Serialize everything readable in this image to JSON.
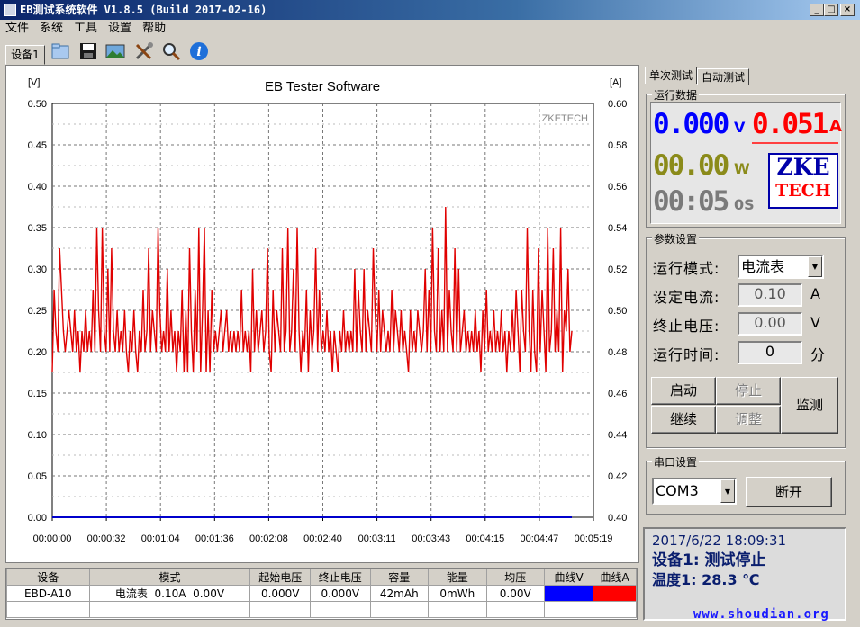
{
  "window": {
    "title": "EB测试系统软件 V1.8.5 (Build 2017-02-16)",
    "min": "_",
    "max": "□",
    "close": "×"
  },
  "menu": [
    "文件",
    "系统",
    "工具",
    "设置",
    "帮助"
  ],
  "device_tab": "设备1",
  "toolbar_icons": [
    "open-folder-icon",
    "save-icon",
    "picture-icon",
    "tools-icon",
    "magnifier-icon",
    "info-icon"
  ],
  "chart_data": {
    "type": "line",
    "title": "EB Tester Software",
    "watermark": "ZKETECH",
    "ylabel_left": "[V]",
    "ylabel_right": "[A]",
    "ylim_left": [
      0,
      0.5
    ],
    "ylim_right": [
      0.4,
      0.6
    ],
    "yticks_left": [
      "0.50",
      "0.45",
      "0.40",
      "0.35",
      "0.30",
      "0.25",
      "0.20",
      "0.15",
      "0.10",
      "0.05",
      "0.00"
    ],
    "yticks_right": [
      "0.60",
      "0.58",
      "0.56",
      "0.54",
      "0.52",
      "0.50",
      "0.48",
      "0.46",
      "0.44",
      "0.42",
      "0.40"
    ],
    "xticks": [
      "00:00:00",
      "00:00:32",
      "00:01:04",
      "00:01:36",
      "00:02:08",
      "00:02:40",
      "00:03:11",
      "00:03:43",
      "00:04:15",
      "00:04:47",
      "00:05:19"
    ],
    "xlim_seconds": [
      0,
      319
    ],
    "series": [
      {
        "axis": "right",
        "color": "#e00000",
        "values": [
          0.47,
          0.51,
          0.49,
          0.48,
          0.53,
          0.51,
          0.49,
          0.48,
          0.49,
          0.5,
          0.49,
          0.48,
          0.5,
          0.48,
          0.49,
          0.47,
          0.49,
          0.48,
          0.5,
          0.48,
          0.49,
          0.48,
          0.51,
          0.48,
          0.54,
          0.5,
          0.48,
          0.54,
          0.49,
          0.48,
          0.52,
          0.48,
          0.53,
          0.49,
          0.48,
          0.5,
          0.48,
          0.49,
          0.48,
          0.5,
          0.48,
          0.47,
          0.49,
          0.48,
          0.5,
          0.48,
          0.47,
          0.49,
          0.48,
          0.51,
          0.48,
          0.49,
          0.53,
          0.48,
          0.5,
          0.49,
          0.48,
          0.54,
          0.5,
          0.48,
          0.49,
          0.48,
          0.52,
          0.48,
          0.5,
          0.48,
          0.49,
          0.47,
          0.49,
          0.48,
          0.51,
          0.47,
          0.5,
          0.47,
          0.53,
          0.49,
          0.47,
          0.51,
          0.48,
          0.54,
          0.47,
          0.5,
          0.54,
          0.47,
          0.5,
          0.47,
          0.51,
          0.48,
          0.49,
          0.48,
          0.49,
          0.5,
          0.48,
          0.49,
          0.5,
          0.48,
          0.49,
          0.48,
          0.49,
          0.48,
          0.49,
          0.48,
          0.51,
          0.48,
          0.49,
          0.48,
          0.49,
          0.47,
          0.52,
          0.48,
          0.5,
          0.48,
          0.49,
          0.5,
          0.48,
          0.49,
          0.53,
          0.48,
          0.47,
          0.51,
          0.48,
          0.5,
          0.49,
          0.48,
          0.53,
          0.48,
          0.49,
          0.54,
          0.48,
          0.49,
          0.52,
          0.48,
          0.54,
          0.49,
          0.47,
          0.49,
          0.48,
          0.51,
          0.47,
          0.5,
          0.48,
          0.49,
          0.53,
          0.48,
          0.51,
          0.48,
          0.49,
          0.48,
          0.5,
          0.48,
          0.49,
          0.47,
          0.49,
          0.48,
          0.47,
          0.49,
          0.48,
          0.5,
          0.48,
          0.49,
          0.48,
          0.49,
          0.48,
          0.52,
          0.48,
          0.51,
          0.49,
          0.48,
          0.52,
          0.48,
          0.5,
          0.49,
          0.48,
          0.53,
          0.5,
          0.48,
          0.51,
          0.48,
          0.5,
          0.49,
          0.48,
          0.49,
          0.48,
          0.51,
          0.48,
          0.5,
          0.49,
          0.48,
          0.5,
          0.48,
          0.49,
          0.48,
          0.47,
          0.5,
          0.48,
          0.49,
          0.48,
          0.5,
          0.49,
          0.48,
          0.49,
          0.52,
          0.48,
          0.51,
          0.48,
          0.54,
          0.49,
          0.48,
          0.53,
          0.48,
          0.5,
          0.48,
          0.55,
          0.48,
          0.51,
          0.49,
          0.48,
          0.53,
          0.48,
          0.52,
          0.48,
          0.49,
          0.5,
          0.48,
          0.49,
          0.48,
          0.49,
          0.48,
          0.5,
          0.48,
          0.49,
          0.47,
          0.5,
          0.48,
          0.51,
          0.48,
          0.49,
          0.48,
          0.5,
          0.48,
          0.49,
          0.48,
          0.5,
          0.48,
          0.49,
          0.47,
          0.49,
          0.48,
          0.5,
          0.48,
          0.51,
          0.49,
          0.47,
          0.51,
          0.49,
          0.48,
          0.54,
          0.49,
          0.47,
          0.51,
          0.48,
          0.47,
          0.53,
          0.48,
          0.51,
          0.49,
          0.47,
          0.54,
          0.48,
          0.49,
          0.53,
          0.48,
          0.5,
          0.48,
          0.54,
          0.47,
          0.5,
          0.49,
          0.52,
          0.48,
          0.49
        ]
      },
      {
        "axis": "left",
        "color": "#0000cc",
        "values": [
          0,
          0
        ]
      }
    ]
  },
  "right_tabs": {
    "single": "单次测试",
    "auto": "自动测试"
  },
  "run_data": {
    "title": "运行数据",
    "voltage": "0.000",
    "voltage_unit": "V",
    "current": "0.051",
    "current_unit": "A",
    "power": "00.00",
    "power_unit": "W",
    "time": "00:05",
    "time_unit": "0S",
    "logo_top": "ZKE",
    "logo_bottom": "TECH"
  },
  "params": {
    "title": "参数设置",
    "mode_label": "运行模式:",
    "mode_value": "电流表",
    "set_current_label": "设定电流:",
    "set_current_value": "0.10",
    "set_current_unit": "A",
    "stop_voltage_label": "终止电压:",
    "stop_voltage_value": "0.00",
    "stop_voltage_unit": "V",
    "run_time_label": "运行时间:",
    "run_time_value": "0",
    "run_time_unit": "分",
    "btn_start": "启动",
    "btn_stop": "停止",
    "btn_monitor": "监测",
    "btn_continue": "继续",
    "btn_adjust": "调整"
  },
  "serial": {
    "title": "串口设置",
    "port": "COM3",
    "btn_disconnect": "断开"
  },
  "status": {
    "line1": "2017/6/22 18:09:31",
    "line2": "设备1: 测试停止",
    "line3": "温度1: 28.3 ℃"
  },
  "table": {
    "headers": [
      "设备",
      "模式",
      "起始电压",
      "终止电压",
      "容量",
      "能量",
      "均压",
      "曲线V",
      "曲线A"
    ],
    "row": [
      "EBD-A10",
      "电流表  0.10A  0.00V",
      "0.000V",
      "0.000V",
      "42mAh",
      "0mWh",
      "0.00V",
      "",
      ""
    ],
    "curve_v_color": "#0000ff",
    "curve_a_color": "#ff0000"
  },
  "watermark": "www.shoudian.org"
}
